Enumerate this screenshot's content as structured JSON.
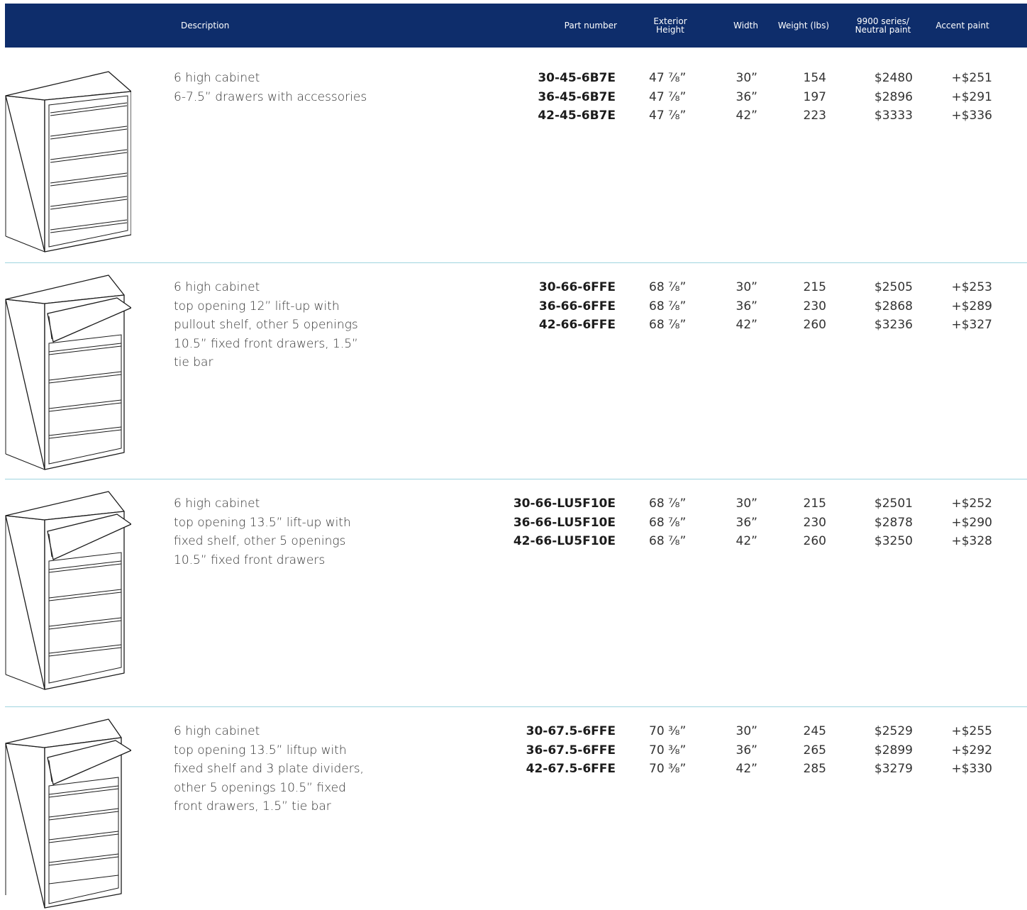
{
  "header": {
    "description": "Description",
    "part_number": "Part number",
    "exterior_height": "Exterior\nHeight",
    "width": "Width",
    "weight": "Weight (lbs)",
    "neutral_paint": "9900 series/\nNeutral paint",
    "accent_paint": "Accent paint",
    "background_color": "#0e2d6b"
  },
  "rows": [
    {
      "description": [
        "6 high cabinet",
        "6-7.5” drawers with accessories"
      ],
      "image_icon": "lateral-file-cabinet-6-drawer-icon",
      "part_numbers": [
        "30-45-6B7E",
        "36-45-6B7E",
        "42-45-6B7E"
      ],
      "heights": [
        "47 ⅞”",
        "47 ⅞”",
        "47 ⅞”"
      ],
      "widths": [
        "30”",
        "36”",
        "42”"
      ],
      "weights": [
        "154",
        "197",
        "223"
      ],
      "neutral_prices": [
        "$2480",
        "$2896",
        "$3333"
      ],
      "accent_prices": [
        "+$251",
        "+$291",
        "+$336"
      ]
    },
    {
      "description": [
        "6 high cabinet",
        "top opening 12” lift-up with",
        "pullout shelf, other 5 openings",
        "10.5” fixed front drawers, 1.5”",
        "tie bar"
      ],
      "image_icon": "lateral-file-cabinet-lift-up-icon",
      "part_numbers": [
        "30-66-6FFE",
        "36-66-6FFE",
        "42-66-6FFE"
      ],
      "heights": [
        "68 ⅞”",
        "68 ⅞”",
        "68 ⅞”"
      ],
      "widths": [
        "30”",
        "36”",
        "42”"
      ],
      "weights": [
        "215",
        "230",
        "260"
      ],
      "neutral_prices": [
        "$2505",
        "$2868",
        "$3236"
      ],
      "accent_prices": [
        "+$253",
        "+$289",
        "+$327"
      ]
    },
    {
      "description": [
        "6 high cabinet",
        "top opening 13.5” lift-up with",
        "fixed shelf, other 5 openings",
        "10.5” fixed front drawers"
      ],
      "image_icon": "lateral-file-cabinet-lift-up-icon",
      "part_numbers": [
        "30-66-LU5F10E",
        "36-66-LU5F10E",
        "42-66-LU5F10E"
      ],
      "heights": [
        "68 ⅞”",
        "68 ⅞”",
        "68 ⅞”"
      ],
      "widths": [
        "30”",
        "36”",
        "42”"
      ],
      "weights": [
        "215",
        "230",
        "260"
      ],
      "neutral_prices": [
        "$2501",
        "$2878",
        "$3250"
      ],
      "accent_prices": [
        "+$252",
        "+$290",
        "+$328"
      ]
    },
    {
      "description": [
        "6 high cabinet",
        "top opening 13.5” liftup with",
        "fixed shelf and 3 plate dividers,",
        "other 5 openings 10.5” fixed",
        "front drawers, 1.5” tie bar"
      ],
      "image_icon": "lateral-file-cabinet-lift-up-icon",
      "part_numbers": [
        "30-67.5-6FFE",
        "36-67.5-6FFE",
        "42-67.5-6FFE"
      ],
      "heights": [
        "70 ⅜”",
        "70 ⅜”",
        "70 ⅜”"
      ],
      "widths": [
        "30”",
        "36”",
        "42”"
      ],
      "weights": [
        "245",
        "265",
        "285"
      ],
      "neutral_prices": [
        "$2529",
        "$2899",
        "$3279"
      ],
      "accent_prices": [
        "+$255",
        "+$292",
        "+$330"
      ]
    }
  ]
}
